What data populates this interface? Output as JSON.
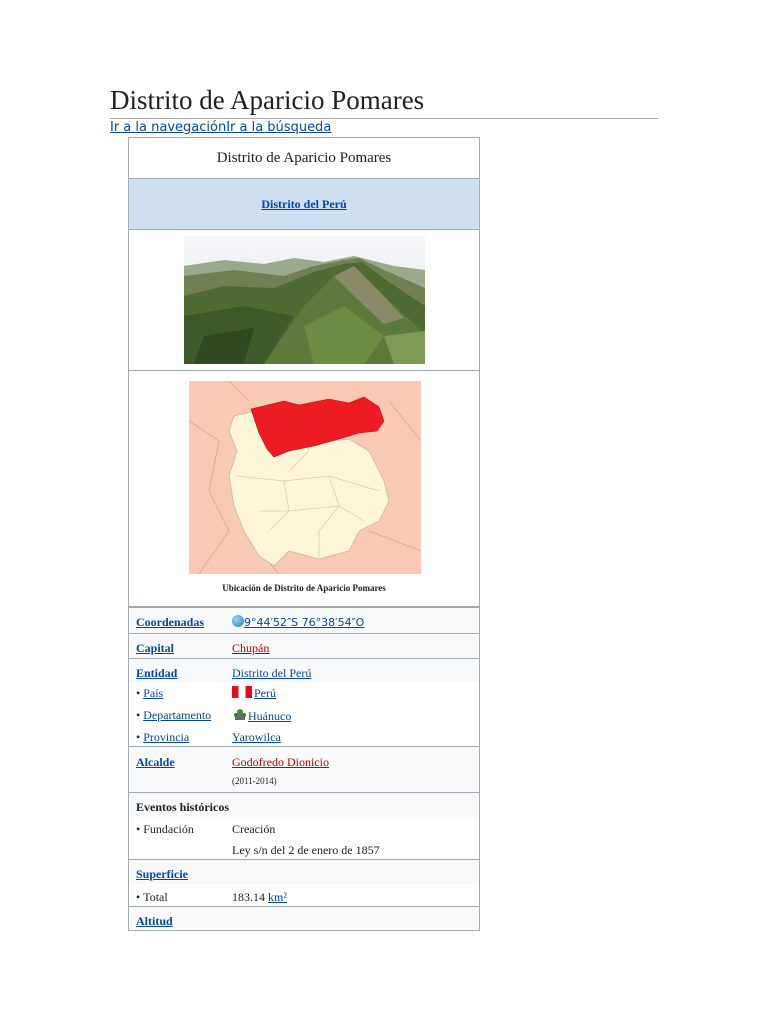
{
  "page": {
    "title": "Distrito de Aparicio Pomares",
    "jump_nav": "Ir a la navegación",
    "jump_search": "Ir a la búsqueda"
  },
  "infobox": {
    "title": "Distrito de Aparicio Pomares",
    "subhead": "Distrito del Perú",
    "map_caption": "Ubicación de Distrito de Aparicio Pomares",
    "rows": {
      "coords_label": "Coordenadas",
      "coords_value": "9°44′52″S 76°38′54″O",
      "capital_label": "Capital",
      "capital_value": "Chupán",
      "entidad_label": "Entidad",
      "entidad_value": "Distrito del Perú",
      "pais_label": "País",
      "pais_value": "Perú",
      "depto_label": "Departamento",
      "depto_value": "Huánuco",
      "provincia_label": "Provincia",
      "provincia_value": "Yarowilca",
      "alcalde_label": "Alcalde",
      "alcalde_value": "Godofredo Dionicio",
      "alcalde_term": "(2011-2014)",
      "eventos_label": "Eventos históricos",
      "fundacion_label": "Fundación",
      "fundacion_value": "Creación",
      "fundacion_detail": "Ley s/n del 2 de enero de 1857",
      "superficie_label": "Superficie",
      "total_label": "Total",
      "total_value": "183.14",
      "total_unit": "km²",
      "altitud_label": "Altitud"
    },
    "bullet": "•"
  },
  "colors": {
    "link": "#0645ad",
    "redlink": "#ba0000",
    "subhead_bg": "#cedff2",
    "map_highlight": "#ed1c24",
    "map_district": "#fdf5d8",
    "map_background": "#f9c9b3"
  }
}
